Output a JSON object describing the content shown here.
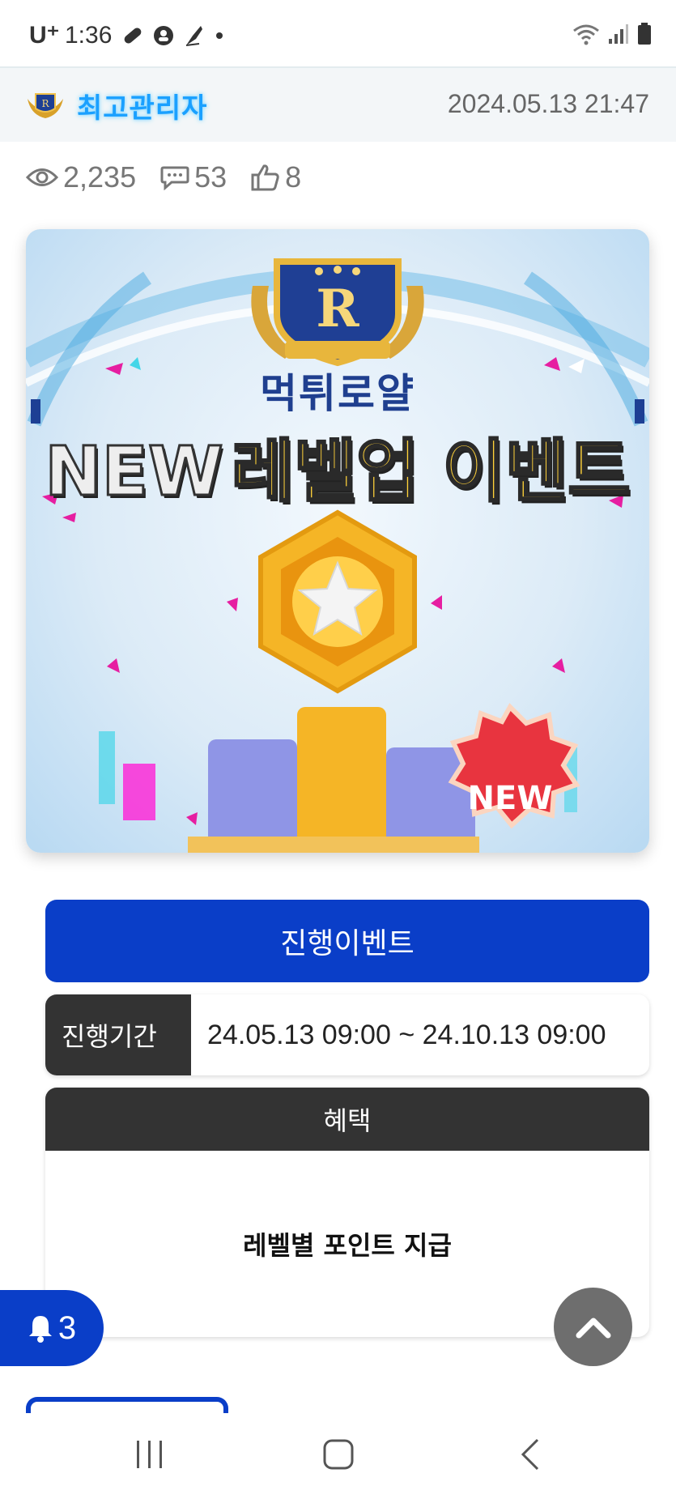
{
  "status_bar": {
    "carrier": "U⁺",
    "time": "1:36"
  },
  "post": {
    "author": "최고관리자",
    "date": "2024.05.13 21:47",
    "views": "2,235",
    "comments": "53",
    "likes": "8"
  },
  "banner": {
    "brand": "먹튀로얄",
    "headline_en": "NEW",
    "headline_ko": "레벨업 이벤트",
    "badge": "NEW",
    "crest_letter": "R"
  },
  "event": {
    "title": "진행이벤트",
    "period_label": "진행기간",
    "period_value": "24.05.13 09:00 ~ 24.10.13 09:00",
    "benefit_label": "혜택",
    "benefit_value": "레벨별 포인트 지급"
  },
  "notification": {
    "count": "3"
  },
  "colors": {
    "primary": "#0a3ec8",
    "dark": "#333333",
    "author": "#1aa0ff"
  }
}
